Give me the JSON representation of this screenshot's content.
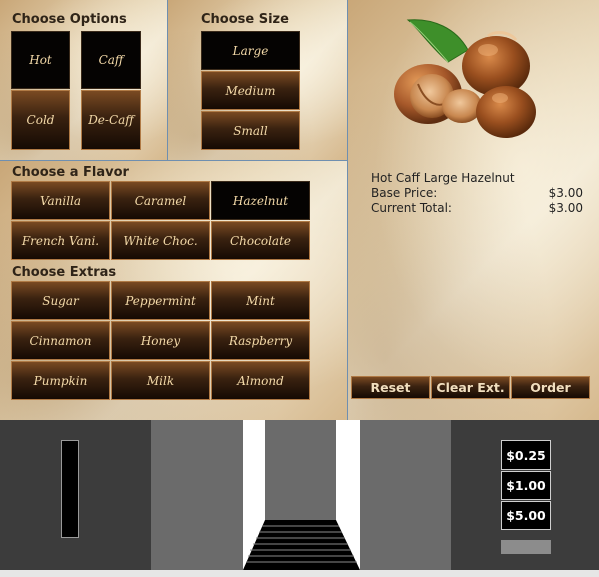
{
  "options": {
    "heading": "Choose Options",
    "buttons": [
      "Hot",
      "Caff",
      "Cold",
      "De-Caff"
    ]
  },
  "size": {
    "heading": "Choose Size",
    "buttons": [
      "Large",
      "Medium",
      "Small"
    ]
  },
  "flavor": {
    "heading": "Choose a Flavor",
    "buttons": [
      "Vanilla",
      "Caramel",
      "Hazelnut",
      "French Vani.",
      "White Choc.",
      "Chocolate"
    ]
  },
  "extras": {
    "heading": "Choose Extras",
    "buttons": [
      "Sugar",
      "Peppermint",
      "Mint",
      "Cinnamon",
      "Honey",
      "Raspberry",
      "Pumpkin",
      "Milk",
      "Almond"
    ]
  },
  "order": {
    "description": "Hot Caff Large Hazelnut",
    "base_price_label": "Base Price:",
    "base_price_value": "$3.00",
    "current_total_label": "Current Total:",
    "current_total_value": "$3.00"
  },
  "actions": {
    "reset": "Reset",
    "clear": "Clear Ext.",
    "order": "Order"
  },
  "coins": [
    "$0.25",
    "$1.00",
    "$5.00"
  ],
  "image": {
    "subject": "hazelnut-illustration"
  },
  "colors": {
    "button_dark": "#050302",
    "button_gradient_top": "#7a4a22",
    "button_text": "#f3d9a8",
    "machine_dark": "#3c3c3c",
    "machine_mid": "#6b6b6b"
  }
}
